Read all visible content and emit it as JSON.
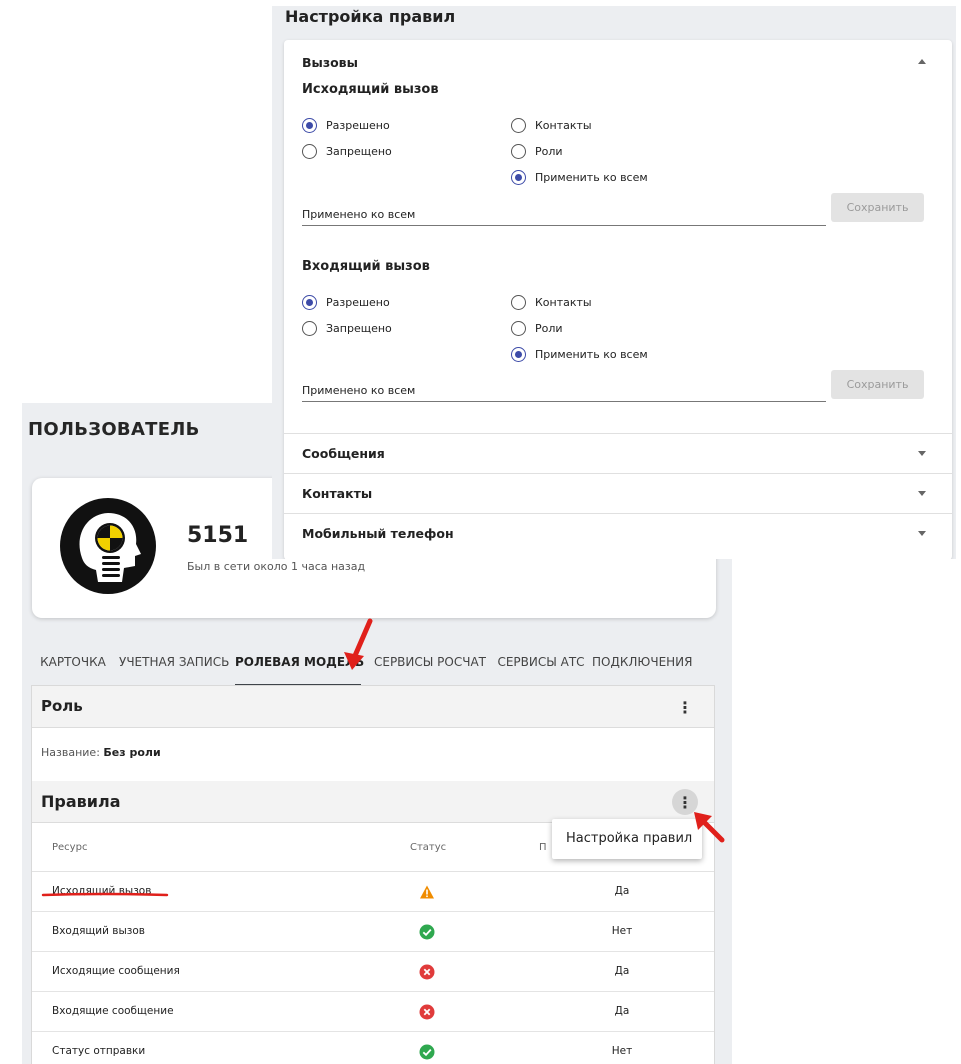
{
  "user_page": {
    "title": "ПОЛЬЗОВАТЕЛЬ",
    "profile": {
      "number": "5151",
      "last_seen": "Был в сети около 1 часа назад"
    },
    "tabs": [
      {
        "label": "КАРТОЧКА",
        "active": false
      },
      {
        "label": "УЧЕТНАЯ ЗАПИСЬ",
        "active": false
      },
      {
        "label": "РОЛЕВАЯ МОДЕЛЬ",
        "active": true
      },
      {
        "label": "СЕРВИСЫ РОСЧАТ",
        "active": false
      },
      {
        "label": "СЕРВИСЫ АТС",
        "active": false
      },
      {
        "label": "ПОДКЛЮЧЕНИЯ",
        "active": false
      }
    ],
    "role": {
      "heading": "Роль",
      "name_label": "Название:",
      "name_value": "Без роли"
    },
    "rules": {
      "heading": "Правила",
      "columns": {
        "resource": "Ресурс",
        "status": "Статус",
        "third": "П"
      },
      "rows": [
        {
          "resource": "Исходящий вызов",
          "status": "warning",
          "value": "Да"
        },
        {
          "resource": "Входящий вызов",
          "status": "ok",
          "value": "Нет"
        },
        {
          "resource": "Исходящие сообщения",
          "status": "error",
          "value": "Да"
        },
        {
          "resource": "Входящие сообщение",
          "status": "error",
          "value": "Да"
        },
        {
          "resource": "Статус отправки",
          "status": "ok",
          "value": "Нет"
        }
      ],
      "menu_item": "Настройка правил"
    }
  },
  "rules_settings": {
    "title": "Настройка правил",
    "section": "Вызовы",
    "groups": [
      {
        "title": "Исходящий вызов",
        "permission": {
          "allowed": "Разрешено",
          "forbidden": "Запрещено",
          "selected": "allowed"
        },
        "scope": {
          "contacts": "Контакты",
          "roles": "Роли",
          "all": "Применить ко всем",
          "selected": "all"
        },
        "field_value": "Применено ко всем",
        "save_label": "Сохранить"
      },
      {
        "title": "Входящий вызов",
        "permission": {
          "allowed": "Разрешено",
          "forbidden": "Запрещено",
          "selected": "allowed"
        },
        "scope": {
          "contacts": "Контакты",
          "roles": "Роли",
          "all": "Применить ко всем",
          "selected": "all"
        },
        "field_value": "Применено ко всем",
        "save_label": "Сохранить"
      }
    ],
    "collapsed_sections": [
      "Сообщения",
      "Контакты",
      "Мобильный телефон"
    ]
  },
  "colors": {
    "accent": "#3d4ba8",
    "warning": "#f08c00",
    "ok": "#2fa84f",
    "error": "#e03b3b",
    "annotation": "#e0201b"
  }
}
